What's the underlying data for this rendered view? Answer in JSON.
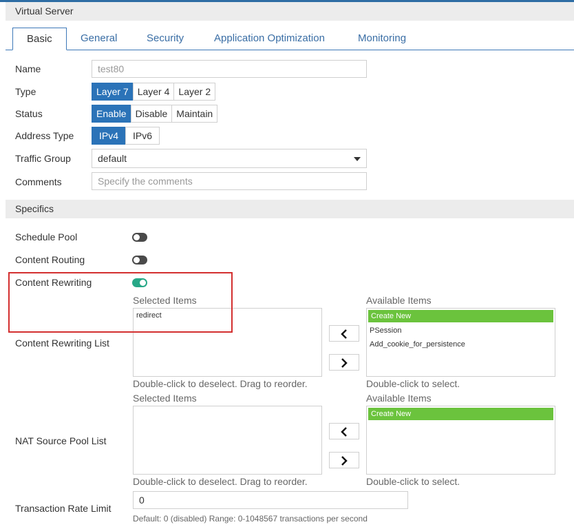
{
  "window": {
    "title": "Virtual Server"
  },
  "tabs": [
    {
      "label": "Basic",
      "active": true
    },
    {
      "label": "General",
      "active": false
    },
    {
      "label": "Security",
      "active": false
    },
    {
      "label": "Application Optimization",
      "active": false
    },
    {
      "label": "Monitoring",
      "active": false
    }
  ],
  "form": {
    "name": {
      "label": "Name",
      "value": "test80"
    },
    "type": {
      "label": "Type",
      "options": [
        "Layer 7",
        "Layer 4",
        "Layer 2"
      ],
      "selected": "Layer 7"
    },
    "status": {
      "label": "Status",
      "options": [
        "Enable",
        "Disable",
        "Maintain"
      ],
      "selected": "Enable"
    },
    "address_type": {
      "label": "Address Type",
      "options": [
        "IPv4",
        "IPv6"
      ],
      "selected": "IPv4"
    },
    "traffic_group": {
      "label": "Traffic Group",
      "value": "default"
    },
    "comments": {
      "label": "Comments",
      "placeholder": "Specify the comments"
    }
  },
  "specifics": {
    "title": "Specifics",
    "schedule_pool": {
      "label": "Schedule Pool",
      "enabled": false
    },
    "content_routing": {
      "label": "Content Routing",
      "enabled": false
    },
    "content_rewriting": {
      "label": "Content Rewriting",
      "enabled": true
    },
    "content_rewriting_list": {
      "label": "Content Rewriting List",
      "selected_title": "Selected Items",
      "available_title": "Available Items",
      "selected_items": [
        "redirect"
      ],
      "available_items": [
        "Create New",
        "PSession",
        "Add_cookie_for_persistence"
      ],
      "selected_hint": "Double-click to deselect. Drag to reorder.",
      "available_hint": "Double-click to select."
    },
    "nat_source_pool_list": {
      "label": "NAT Source Pool List",
      "selected_title": "Selected Items",
      "available_title": "Available Items",
      "selected_items": [],
      "available_items": [
        "Create New"
      ],
      "selected_hint": "Double-click to deselect. Drag to reorder.",
      "available_hint": "Double-click to select."
    },
    "transaction_rate_limit": {
      "label": "Transaction Rate Limit",
      "value": "0",
      "hint": "Default: 0 (disabled) Range: 0-1048567 transactions per second"
    }
  },
  "colors": {
    "accent": "#2b73b8",
    "toggle_on": "#27a887",
    "create_new": "#6bc33d",
    "highlight": "#d32f2f"
  }
}
